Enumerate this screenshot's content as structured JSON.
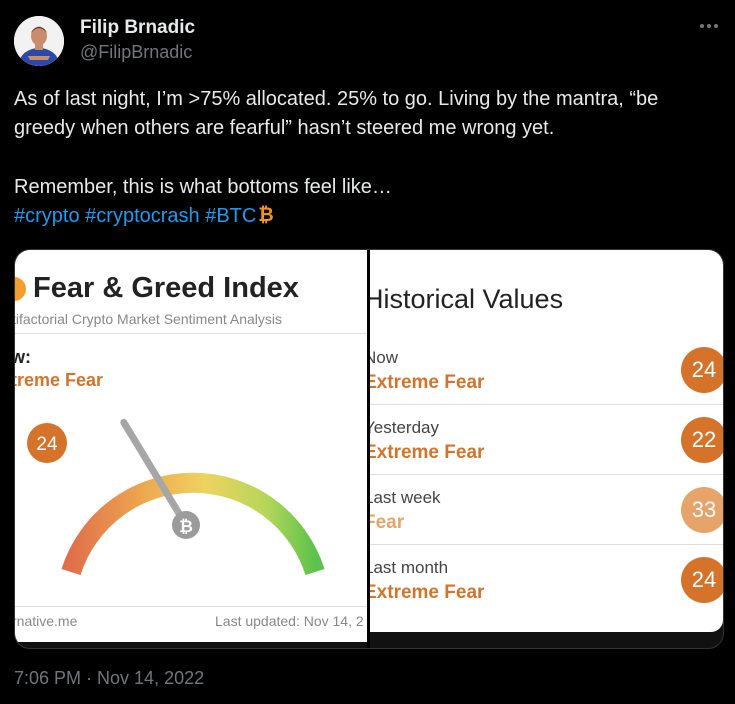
{
  "author": {
    "name": "Filip Brnadic",
    "handle": "@FilipBrnadic"
  },
  "more_icon": "more-horizontal-icon",
  "tweet": {
    "line1": "As of last night, I’m >75% allocated. 25% to go. Living by the mantra, “be greedy when others are fearful” hasn’t steered me wrong yet.",
    "line2": "Remember, this is what bottoms feel like…",
    "hashtags": [
      "#crypto",
      "#cryptocrash",
      "#BTC"
    ],
    "emoji": "bitcoin-icon"
  },
  "media": {
    "gauge_panel": {
      "title": "Fear & Greed Index",
      "subtitle": "tifactorial Crypto Market Sentiment Analysis",
      "now_label": "w:",
      "classification": "treme Fear",
      "value": "24",
      "value_fraction": 0.24,
      "source": "rnative.me",
      "updated": "Last updated: Nov 14, 2"
    },
    "historical_panel": {
      "title": "Historical Values",
      "rows": [
        {
          "label": "Now",
          "classification": "Extreme Fear",
          "value": "24",
          "color": "#d5732b"
        },
        {
          "label": "Yesterday",
          "classification": "Extreme Fear",
          "value": "22",
          "color": "#d5732b"
        },
        {
          "label": "Last week",
          "classification": "Fear",
          "value": "33",
          "color": "#e6a36a"
        },
        {
          "label": "Last month",
          "classification": "Extreme Fear",
          "value": "24",
          "color": "#d5732b"
        }
      ]
    }
  },
  "timestamp": "7:06 PM · Nov 14, 2022",
  "colors": {
    "link": "#1d9bf0",
    "extreme_fear": "#d5732b",
    "fear": "#e6a36a",
    "muted": "#71767b"
  }
}
